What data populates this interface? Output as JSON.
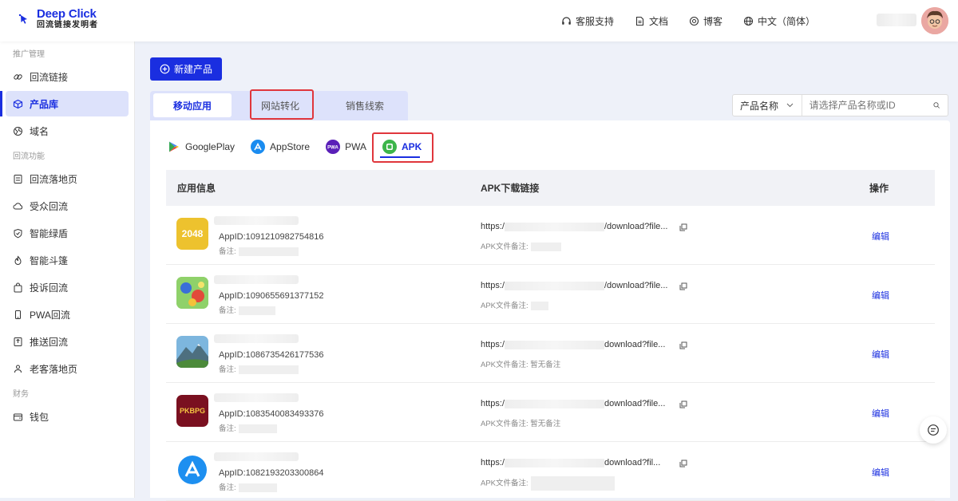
{
  "brand": {
    "title": "Deep Click",
    "subtitle": "回流链接发明者",
    "color": "#1a2ee0"
  },
  "topnav": [
    {
      "label": "客服支持",
      "icon": "headset-icon"
    },
    {
      "label": "文档",
      "icon": "document-icon"
    },
    {
      "label": "博客",
      "icon": "blog-icon"
    },
    {
      "label": "中文（简体）",
      "icon": "globe-icon"
    }
  ],
  "sidebar": {
    "sections": [
      {
        "title": "推广管理",
        "items": [
          {
            "label": "回流链接",
            "icon": "link-icon"
          },
          {
            "label": "产品库",
            "icon": "cube-icon",
            "active": true
          },
          {
            "label": "域名",
            "icon": "domain-icon"
          }
        ]
      },
      {
        "title": "回流功能",
        "items": [
          {
            "label": "回流落地页",
            "icon": "landing-page-icon"
          },
          {
            "label": "受众回流",
            "icon": "cloud-icon"
          },
          {
            "label": "智能绿盾",
            "icon": "shield-icon"
          },
          {
            "label": "智能斗篷",
            "icon": "fire-icon"
          },
          {
            "label": "投诉回流",
            "icon": "bag-icon"
          },
          {
            "label": "PWA回流",
            "icon": "phone-icon"
          },
          {
            "label": "推送回流",
            "icon": "push-icon"
          },
          {
            "label": "老客落地页",
            "icon": "users-icon"
          }
        ]
      },
      {
        "title": "财务",
        "items": [
          {
            "label": "钱包",
            "icon": "wallet-icon"
          }
        ]
      }
    ]
  },
  "main": {
    "new_button": "新建产品",
    "type_tabs": [
      {
        "label": "移动应用",
        "active": true
      },
      {
        "label": "网站转化",
        "highlighted": true
      },
      {
        "label": "销售线索"
      }
    ],
    "search": {
      "select_label": "产品名称",
      "placeholder": "请选择产品名称或ID"
    },
    "platform_tabs": [
      {
        "label": "GooglePlay",
        "icon": "google-play-icon"
      },
      {
        "label": "AppStore",
        "icon": "app-store-icon"
      },
      {
        "label": "PWA",
        "icon": "pwa-icon"
      },
      {
        "label": "APK",
        "icon": "android-icon",
        "active": true
      }
    ],
    "table": {
      "headers": [
        "应用信息",
        "APK下载链接",
        "操作"
      ],
      "note_label": "备注:",
      "file_note_label": "APK文件备注:",
      "rows": [
        {
          "icon": "2048-game-icon",
          "icon_text": "2048",
          "app_id": "AppID:1091210982754816",
          "url_prefix": "https:/",
          "url_suffix": "/download?file...",
          "file_note": "",
          "action": "编辑"
        },
        {
          "icon": "cartoon-game-icon",
          "icon_text": "",
          "app_id": "AppID:1090655691377152",
          "url_prefix": "https:/",
          "url_suffix": "/download?file...",
          "file_note": "",
          "action": "编辑"
        },
        {
          "icon": "mountain-app-icon",
          "icon_text": "",
          "app_id": "AppID:1086735426177536",
          "url_prefix": "https:/",
          "url_suffix": "download?file...",
          "file_note": "暂无备注",
          "action": "编辑"
        },
        {
          "icon": "pkbpg-game-icon",
          "icon_text": "PKBPG",
          "app_id": "AppID:1083540083493376",
          "url_prefix": "https:/",
          "url_suffix": "download?file...",
          "file_note": "暂无备注",
          "action": "编辑"
        },
        {
          "icon": "app-store-app-icon",
          "icon_text": "",
          "app_id": "AppID:1082193203300864",
          "url_prefix": "https:/",
          "url_suffix": "download?fil...",
          "file_note": "",
          "action": "编辑"
        }
      ]
    }
  }
}
